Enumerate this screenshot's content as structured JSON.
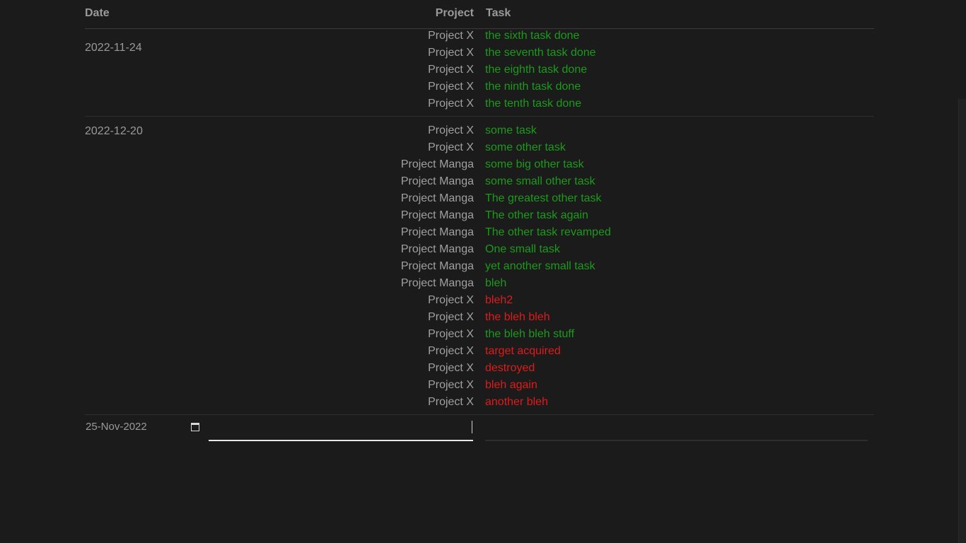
{
  "header": {
    "date_label": "Date",
    "project_label": "Project",
    "task_label": "Task"
  },
  "groups": [
    {
      "date": "2022-11-24",
      "entries": [
        {
          "project": "Project X",
          "task": "the sixth task done",
          "status": "done"
        },
        {
          "project": "Project X",
          "task": "the seventh task done",
          "status": "done"
        },
        {
          "project": "Project X",
          "task": "the eighth task done",
          "status": "done"
        },
        {
          "project": "Project X",
          "task": "the ninth task done",
          "status": "done"
        },
        {
          "project": "Project X",
          "task": "the tenth task done",
          "status": "done"
        }
      ]
    },
    {
      "date": "2022-12-20",
      "entries": [
        {
          "project": "Project X",
          "task": "some task",
          "status": "done"
        },
        {
          "project": "Project X",
          "task": "some other task",
          "status": "done"
        },
        {
          "project": "Project Manga",
          "task": "some big other task",
          "status": "done"
        },
        {
          "project": "Project Manga",
          "task": "some small other task",
          "status": "done"
        },
        {
          "project": "Project Manga",
          "task": "The greatest other task",
          "status": "done"
        },
        {
          "project": "Project Manga",
          "task": "The other task again",
          "status": "done"
        },
        {
          "project": "Project Manga",
          "task": "The other task revamped",
          "status": "done"
        },
        {
          "project": "Project Manga",
          "task": "One small task",
          "status": "done"
        },
        {
          "project": "Project Manga",
          "task": "yet another small task",
          "status": "done"
        },
        {
          "project": "Project Manga",
          "task": "bleh",
          "status": "done"
        },
        {
          "project": "Project X",
          "task": "bleh2",
          "status": "todo"
        },
        {
          "project": "Project X",
          "task": "the bleh bleh",
          "status": "todo"
        },
        {
          "project": "Project X",
          "task": "the bleh bleh stuff",
          "status": "done"
        },
        {
          "project": "Project X",
          "task": "target acquired",
          "status": "todo"
        },
        {
          "project": "Project X",
          "task": "destroyed",
          "status": "todo"
        },
        {
          "project": "Project X",
          "task": "bleh again",
          "status": "todo"
        },
        {
          "project": "Project X",
          "task": "another bleh",
          "status": "todo"
        }
      ]
    }
  ],
  "new_entry": {
    "date_value": "25-Nov-2022",
    "calendar_icon": "calendar-icon",
    "project_value": "",
    "task_value": ""
  },
  "colors": {
    "background": "#1b1b1b",
    "done": "#1c9a1c",
    "todo": "#e01b1b",
    "text": "#a0a0a0"
  }
}
